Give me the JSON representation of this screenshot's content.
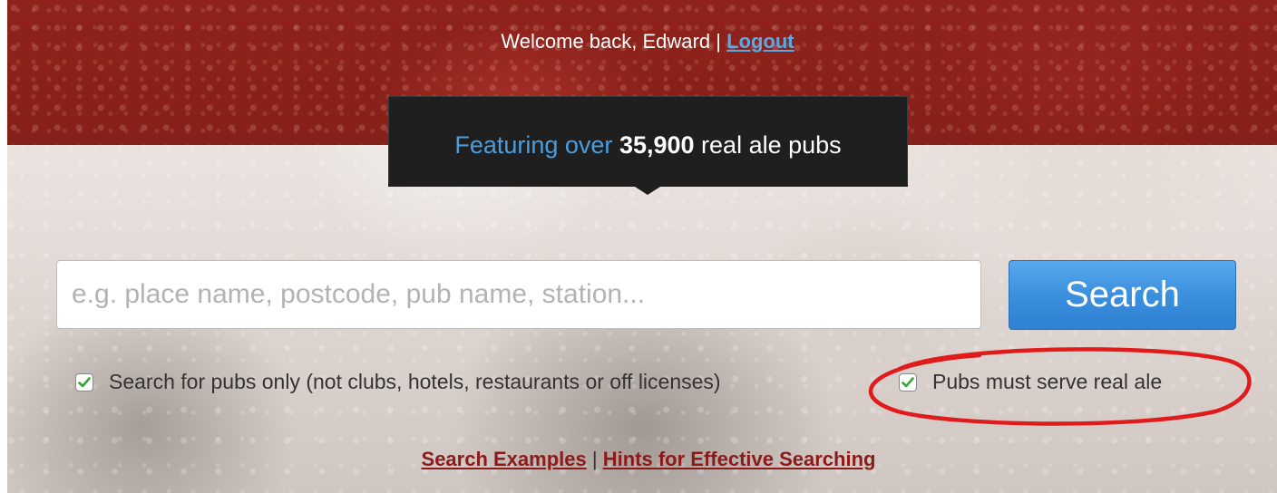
{
  "header": {
    "welcome_text": "Welcome back, Edward",
    "separator": "|",
    "logout_label": "Logout"
  },
  "banner": {
    "prefix": "Featuring over",
    "count": "35,900",
    "suffix": "real ale pubs"
  },
  "search": {
    "placeholder": "e.g. place name, postcode, pub name, station...",
    "value": "",
    "button_label": "Search"
  },
  "options": [
    {
      "label": "Search for pubs only (not clubs, hotels, restaurants or off licenses)",
      "checked": true
    },
    {
      "label": "Pubs must serve real ale",
      "checked": true
    }
  ],
  "footer_links": {
    "examples_label": "Search Examples",
    "separator": "|",
    "hints_label": "Hints for Effective Searching"
  },
  "colors": {
    "header_red": "#8a2119",
    "banner_bg": "#1f1f1f",
    "banner_accent": "#4a9ee0",
    "logout_link": "#58a9e6",
    "search_button": "#3b8fdd",
    "footer_link": "#8b1a1a",
    "annotation_circle": "#e01b1b",
    "checkmark": "#3aa335"
  }
}
